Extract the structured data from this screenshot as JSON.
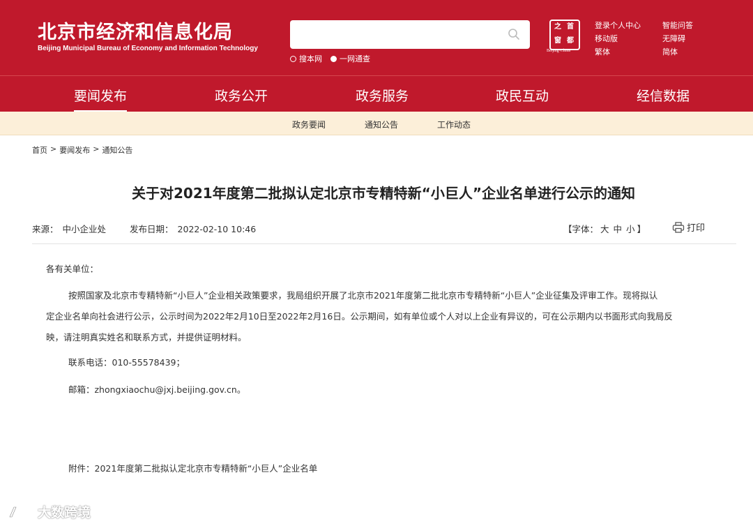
{
  "header": {
    "logo_cn": "北京市经济和信息化局",
    "logo_en": "Beijing Municipal Bureau of Economy and Information Technology",
    "search": {
      "placeholder": "",
      "scope_options": [
        "搜本网",
        "一网通查"
      ]
    },
    "seal": {
      "chars": [
        "首",
        "都",
        "之",
        "窗"
      ],
      "caption": "Beijing·China"
    },
    "links": [
      "登录个人中心",
      "智能问答",
      "移动版",
      "无障碍",
      "繁体",
      "简体"
    ]
  },
  "main_nav": [
    "要闻发布",
    "政务公开",
    "政务服务",
    "政民互动",
    "经信数据"
  ],
  "sub_nav": [
    "政务要闻",
    "通知公告",
    "工作动态"
  ],
  "breadcrumb": [
    "首页",
    "要闻发布",
    "通知公告"
  ],
  "breadcrumb_sep": ">",
  "article": {
    "title": "关于对2021年度第二批拟认定北京市专精特新“小巨人”企业名单进行公示的通知",
    "source_label": "来源：",
    "source": "中小企业处",
    "date_label": "发布日期：",
    "date": "2022-02-10 10:46",
    "font_label": "【字体：",
    "font_sizes": [
      "大",
      "中",
      "小"
    ],
    "font_close": "】",
    "print_label": "打印",
    "salutation": "各有关单位：",
    "paragraph_line1": "按照国家及北京市专精特新“小巨人”企业相关政策要求，我局组织开展了北京市2021年度第二批北京市专精特新“小巨人”企业征集及评审工作。现将拟认",
    "paragraph_line2": "定企业名单向社会进行公示，公示时间为2022年2月10日至2022年2月16日。公示期间，如有单位或个人对以上企业有异议的，可在公示期内以书面形式向我局反",
    "paragraph_line3": "映，请注明真实姓名和联系方式，并提供证明材料。",
    "phone": "联系电话：010-55578439；",
    "email": "邮箱：zhongxiaochu@jxj.beijing.gov.cn。",
    "attachment_label": "附件：",
    "attachment": "2021年度第二批拟认定北京市专精特新“小巨人”企业名单"
  },
  "watermark": "大数跨境",
  "colors": {
    "brand_red": "#c0192c",
    "subnav_bg": "#fcefd9"
  }
}
